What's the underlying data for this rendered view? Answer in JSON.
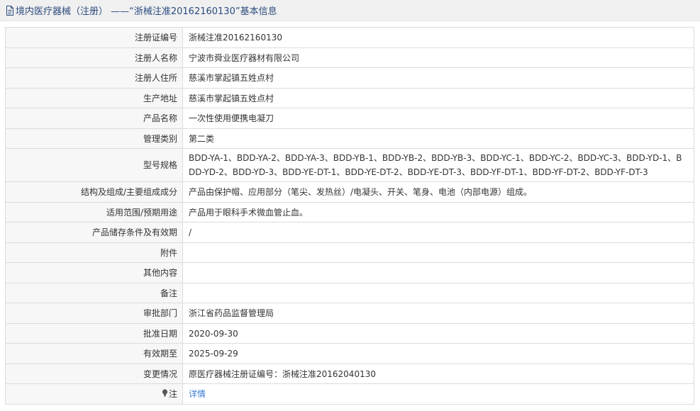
{
  "header": {
    "title": "境内医疗器械（注册） ——“浙械注准20162160130”基本信息"
  },
  "rows": [
    {
      "label": "注册证编号",
      "value": "浙械注准20162160130"
    },
    {
      "label": "注册人名称",
      "value": "宁波市舜业医疗器材有限公司"
    },
    {
      "label": "注册人住所",
      "value": "慈溪市掌起镇五姓点村"
    },
    {
      "label": "生产地址",
      "value": "慈溪市掌起镇五姓点村"
    },
    {
      "label": "产品名称",
      "value": "一次性使用便携电凝刀"
    },
    {
      "label": "管理类别",
      "value": "第二类"
    },
    {
      "label": "型号规格",
      "value": "BDD-YA-1、BDD-YA-2、BDD-YA-3、BDD-YB-1、BDD-YB-2、BDD-YB-3、BDD-YC-1、BDD-YC-2、BDD-YC-3、BDD-YD-1、BDD-YD-2、BDD-YD-3、BDD-YE-DT-1、BDD-YE-DT-2、BDD-YE-DT-3、BDD-YF-DT-1、BDD-YF-DT-2、BDD-YF-DT-3"
    },
    {
      "label": "结构及组成/主要组成成分",
      "value": "产品由保护帽、应用部分（笔尖、发热丝）/电凝头、开关、笔身、电池（内部电源）组成。"
    },
    {
      "label": "适用范围/预期用途",
      "value": "产品用于眼科手术微血管止血。"
    },
    {
      "label": "产品储存条件及有效期",
      "value": "/"
    },
    {
      "label": "附件",
      "value": ""
    },
    {
      "label": "其他内容",
      "value": ""
    },
    {
      "label": "备注",
      "value": ""
    },
    {
      "label": "审批部门",
      "value": "浙江省药品监督管理局"
    },
    {
      "label": "批准日期",
      "value": "2020-09-30"
    },
    {
      "label": "有效期至",
      "value": "2025-09-29"
    },
    {
      "label": "变更情况",
      "value": "原医疗器械注册证编号：浙械注准20162040130"
    }
  ],
  "note": {
    "label": "注",
    "icon": "lightbulb-icon",
    "link_text": "详情"
  },
  "colors": {
    "header_text": "#2b4a7e",
    "label_bg": "#f7f7f7",
    "link": "#3a7ad6",
    "border": "#dcdcdc"
  }
}
